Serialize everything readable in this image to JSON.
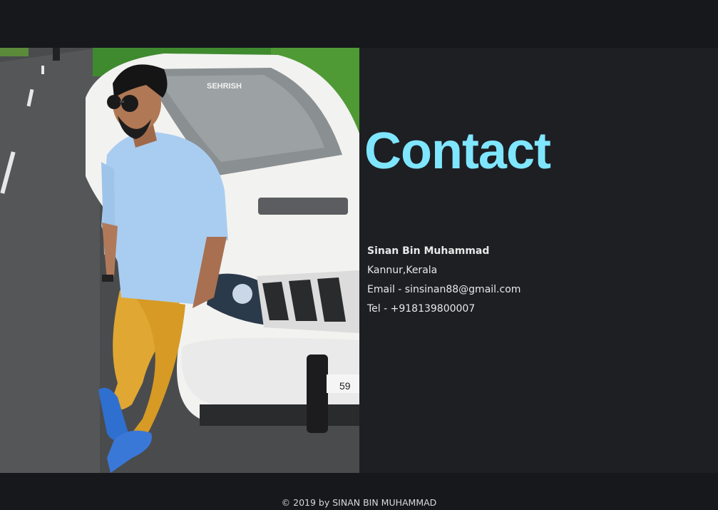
{
  "contact": {
    "title": "Contact",
    "name": "Sinan Bin Muhammad",
    "location": "Kannur,Kerala",
    "email": "Email - sinsinan88@gmail.com",
    "phone": "Tel - +918139800007"
  },
  "photo": {
    "plate_text": "SEHRISH",
    "number_plate": "59"
  },
  "footer": {
    "copyright": "© 2019 by SINAN BIN MUHAMMAD"
  },
  "colors": {
    "background": "#16181c",
    "panel": "#1e1f23",
    "accent": "#7fe6ff",
    "text": "#e8e8e8"
  }
}
